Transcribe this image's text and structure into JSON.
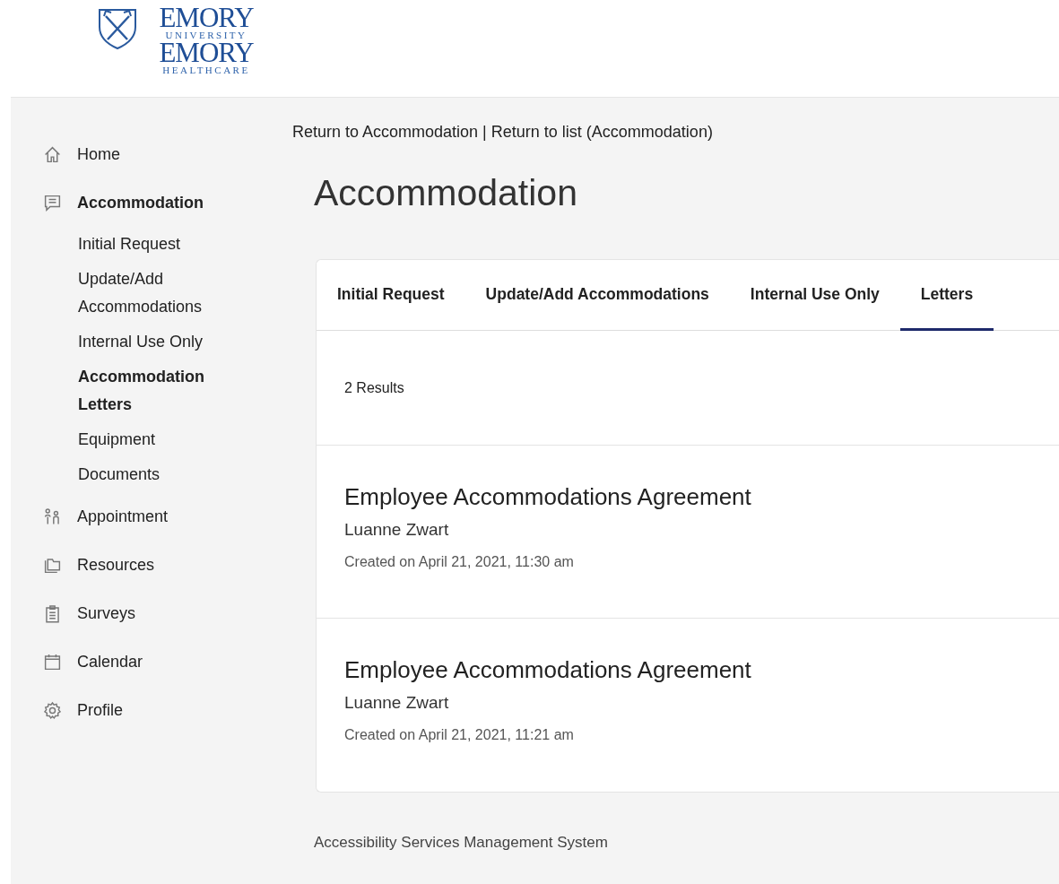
{
  "logo": {
    "lines": [
      {
        "text": "EMORY",
        "kind": "big"
      },
      {
        "text": "UNIVERSITY",
        "kind": "small"
      },
      {
        "text": "EMORY",
        "kind": "big"
      },
      {
        "text": "HEALTHCARE",
        "kind": "small"
      }
    ]
  },
  "sidebar": {
    "items": [
      {
        "label": "Home",
        "kind": "home",
        "selected": false
      },
      {
        "label": "Accommodation",
        "kind": "chat",
        "selected": true,
        "children": [
          {
            "label": "Initial Request",
            "selected": false
          },
          {
            "label": "Update/Add Accommodations",
            "selected": false
          },
          {
            "label": "Internal Use Only",
            "selected": false
          },
          {
            "label": "Accommodation Letters",
            "selected": true
          },
          {
            "label": "Equipment",
            "selected": false
          },
          {
            "label": "Documents",
            "selected": false
          }
        ]
      },
      {
        "label": "Appointment",
        "kind": "people",
        "selected": false
      },
      {
        "label": "Resources",
        "kind": "folder",
        "selected": false
      },
      {
        "label": "Surveys",
        "kind": "clipboard",
        "selected": false
      },
      {
        "label": "Calendar",
        "kind": "calendar",
        "selected": false
      },
      {
        "label": "Profile",
        "kind": "gear",
        "selected": false
      }
    ]
  },
  "breadcrumb": {
    "links": [
      "Return to Accommodation",
      "Return to list (Accommodation)"
    ],
    "separator": "|"
  },
  "page_title": "Accommodation",
  "tabs": [
    {
      "label": "Initial Request",
      "selected": false
    },
    {
      "label": "Update/Add Accommodations",
      "selected": false
    },
    {
      "label": "Internal Use Only",
      "selected": false
    },
    {
      "label": "Letters",
      "selected": true
    }
  ],
  "results_count": "2 Results",
  "letters": [
    {
      "title": "Employee Accommodations Agreement",
      "author": "Luanne Zwart",
      "created": "Created on April 21, 2021, 11:30 am"
    },
    {
      "title": "Employee Accommodations Agreement",
      "author": "Luanne Zwart",
      "created": "Created on April 21, 2021, 11:21 am"
    }
  ],
  "footer": "Accessibility Services Management System"
}
